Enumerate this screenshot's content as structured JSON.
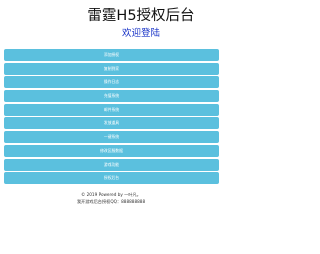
{
  "header": {
    "title": "雷霆H5授权后台",
    "subtitle": "欢迎登陆"
  },
  "menu": {
    "items": [
      {
        "label": "添加授权"
      },
      {
        "label": "复制到家"
      },
      {
        "label": "操作日志"
      },
      {
        "label": "充值系统"
      },
      {
        "label": "邮件系统"
      },
      {
        "label": "发放道具"
      },
      {
        "label": "一键系统"
      },
      {
        "label": "修改区服数据"
      },
      {
        "label": "游戏功能"
      },
      {
        "label": "授权后台"
      }
    ]
  },
  "footer": {
    "copyright": "© 2019 Powered by 一叶凡。",
    "contact": "我开游戏后台授权QQ：888888888"
  },
  "colors": {
    "button_bg": "#5bc0de",
    "subtitle": "#1a35c8"
  }
}
